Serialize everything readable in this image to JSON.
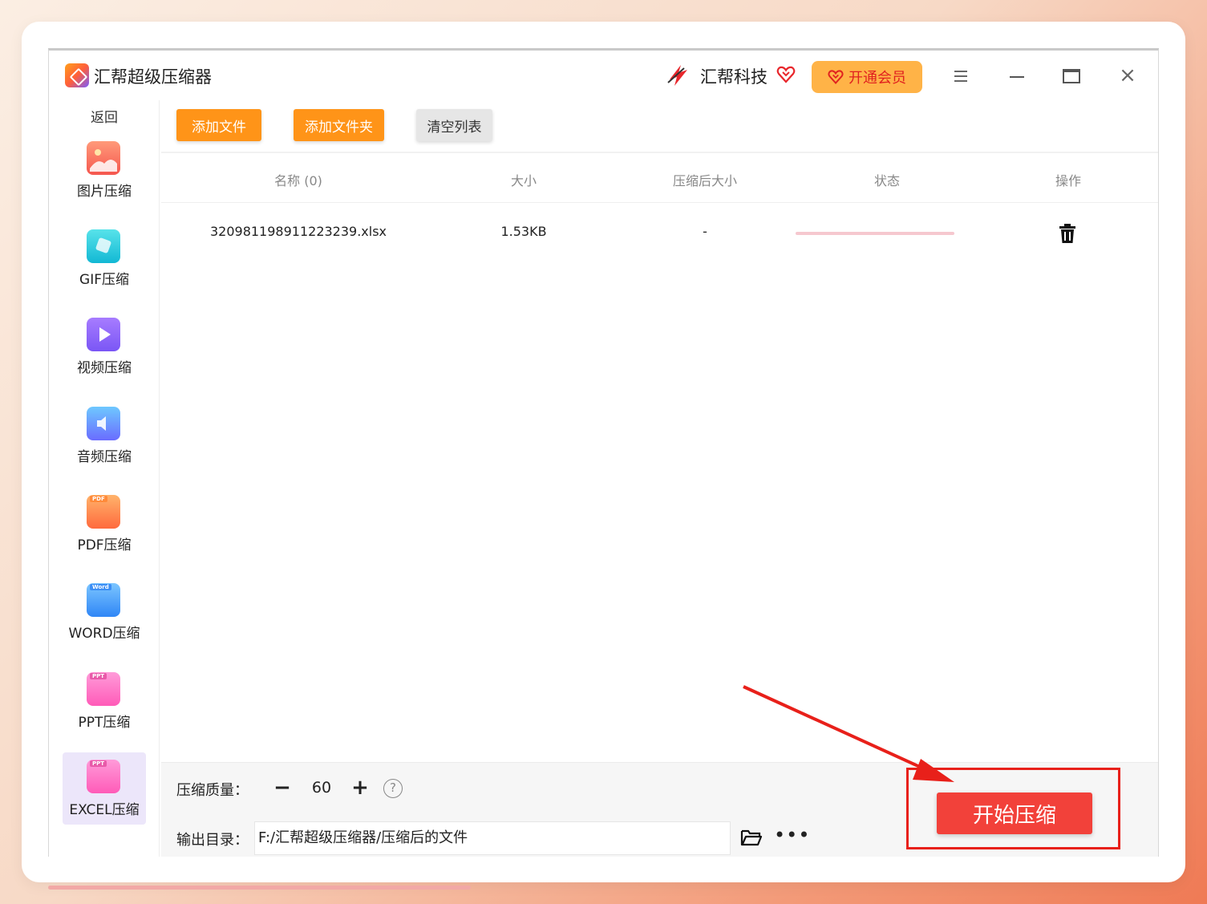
{
  "app": {
    "title": "汇帮超级压缩器",
    "brand_name": "汇帮科技",
    "vip_label": "开通会员"
  },
  "sidebar": {
    "back_label": "返回",
    "items": [
      {
        "label": "图片压缩",
        "icon": "image-icon"
      },
      {
        "label": "GIF压缩",
        "icon": "gif-icon"
      },
      {
        "label": "视频压缩",
        "icon": "video-icon"
      },
      {
        "label": "音频压缩",
        "icon": "audio-icon"
      },
      {
        "label": "PDF压缩",
        "icon": "pdf-icon",
        "tag": "PDF"
      },
      {
        "label": "WORD压缩",
        "icon": "word-icon",
        "tag": "Word"
      },
      {
        "label": "PPT压缩",
        "icon": "ppt-icon",
        "tag": "PPT"
      },
      {
        "label": "EXCEL压缩",
        "icon": "excel-icon",
        "tag": "PPT",
        "active": true
      }
    ]
  },
  "toolbar": {
    "add_file": "添加文件",
    "add_folder": "添加文件夹",
    "clear_list": "清空列表"
  },
  "table": {
    "columns": [
      "名称 (0)",
      "大小",
      "压缩后大小",
      "状态",
      "操作"
    ],
    "rows": [
      {
        "name": "320981198911223239.xlsx",
        "size": "1.53KB",
        "compressed_size": "-",
        "progress": 0
      }
    ]
  },
  "settings": {
    "quality_label": "压缩质量：",
    "quality_value": "60",
    "output_label": "输出目录：",
    "output_path": "F:/汇帮超级压缩器/压缩后的文件",
    "start_label": "开始压缩"
  },
  "colors": {
    "orange": "#ff9418",
    "start_red": "#f2413a",
    "annotation_red": "#e8201a",
    "vip_bg": "#ffb347"
  }
}
